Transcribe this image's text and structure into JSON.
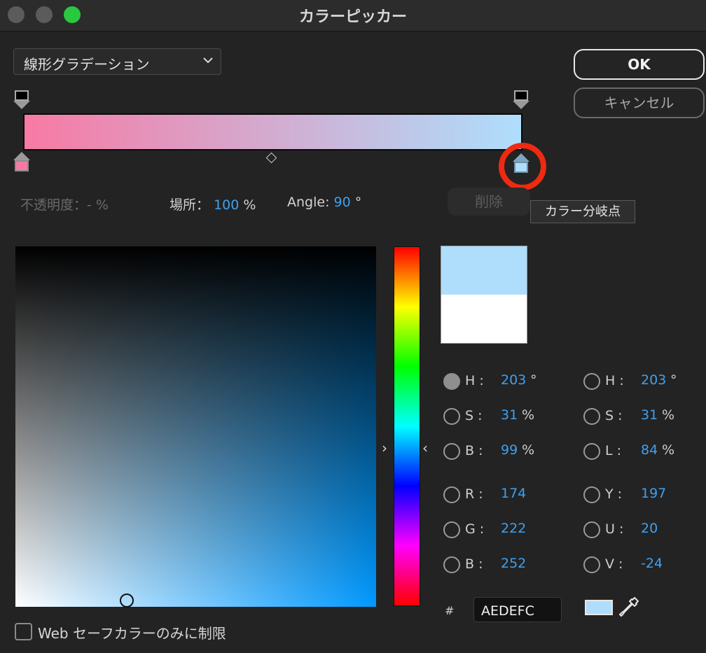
{
  "window": {
    "title": "カラーピッカー"
  },
  "gradient": {
    "type_label": "線形グラデーション",
    "start_color": "#f77aa4",
    "end_color": "#aedefc",
    "tooltip": "カラー分岐点"
  },
  "buttons": {
    "ok": "OK",
    "cancel": "キャンセル",
    "delete": "削除"
  },
  "info": {
    "opacity_label": "不透明度：",
    "opacity_value": "- %",
    "location_label": "場所：",
    "location_value": "100",
    "location_unit": "%",
    "angle_label": "Angle:",
    "angle_value": "90",
    "angle_unit": "°"
  },
  "preview": {
    "new_color": "#aedefc",
    "old_color": "#ffffff"
  },
  "values_left": [
    {
      "label": "H :",
      "value": "203",
      "unit": "°",
      "selected": true
    },
    {
      "label": "S :",
      "value": "31",
      "unit": "%",
      "selected": false
    },
    {
      "label": "B :",
      "value": "99",
      "unit": "%",
      "selected": false
    },
    {
      "label": "R :",
      "value": "174",
      "unit": "",
      "selected": false
    },
    {
      "label": "G :",
      "value": "222",
      "unit": "",
      "selected": false
    },
    {
      "label": "B :",
      "value": "252",
      "unit": "",
      "selected": false
    }
  ],
  "values_right": [
    {
      "label": "H :",
      "value": "203",
      "unit": "°",
      "selected": false
    },
    {
      "label": "S :",
      "value": "31",
      "unit": "%",
      "selected": false
    },
    {
      "label": "L :",
      "value": "84",
      "unit": "%",
      "selected": false
    },
    {
      "label": "Y :",
      "value": "197",
      "unit": "",
      "selected": false
    },
    {
      "label": "U :",
      "value": "20",
      "unit": "",
      "selected": false
    },
    {
      "label": "V :",
      "value": "-24",
      "unit": "",
      "selected": false
    }
  ],
  "hex": {
    "hash": "#",
    "value": "AEDEFC"
  },
  "websafe": {
    "label": "Web セーフカラーのみに制限",
    "checked": false
  },
  "icons": {
    "dropdown": "chevron-down-icon",
    "eyedropper": "eyedropper-icon",
    "hue_left": "chevron-right-icon",
    "hue_right": "chevron-left-icon"
  },
  "colors": {
    "accent": "#3fa0f0",
    "highlight": "#ee2a10"
  }
}
